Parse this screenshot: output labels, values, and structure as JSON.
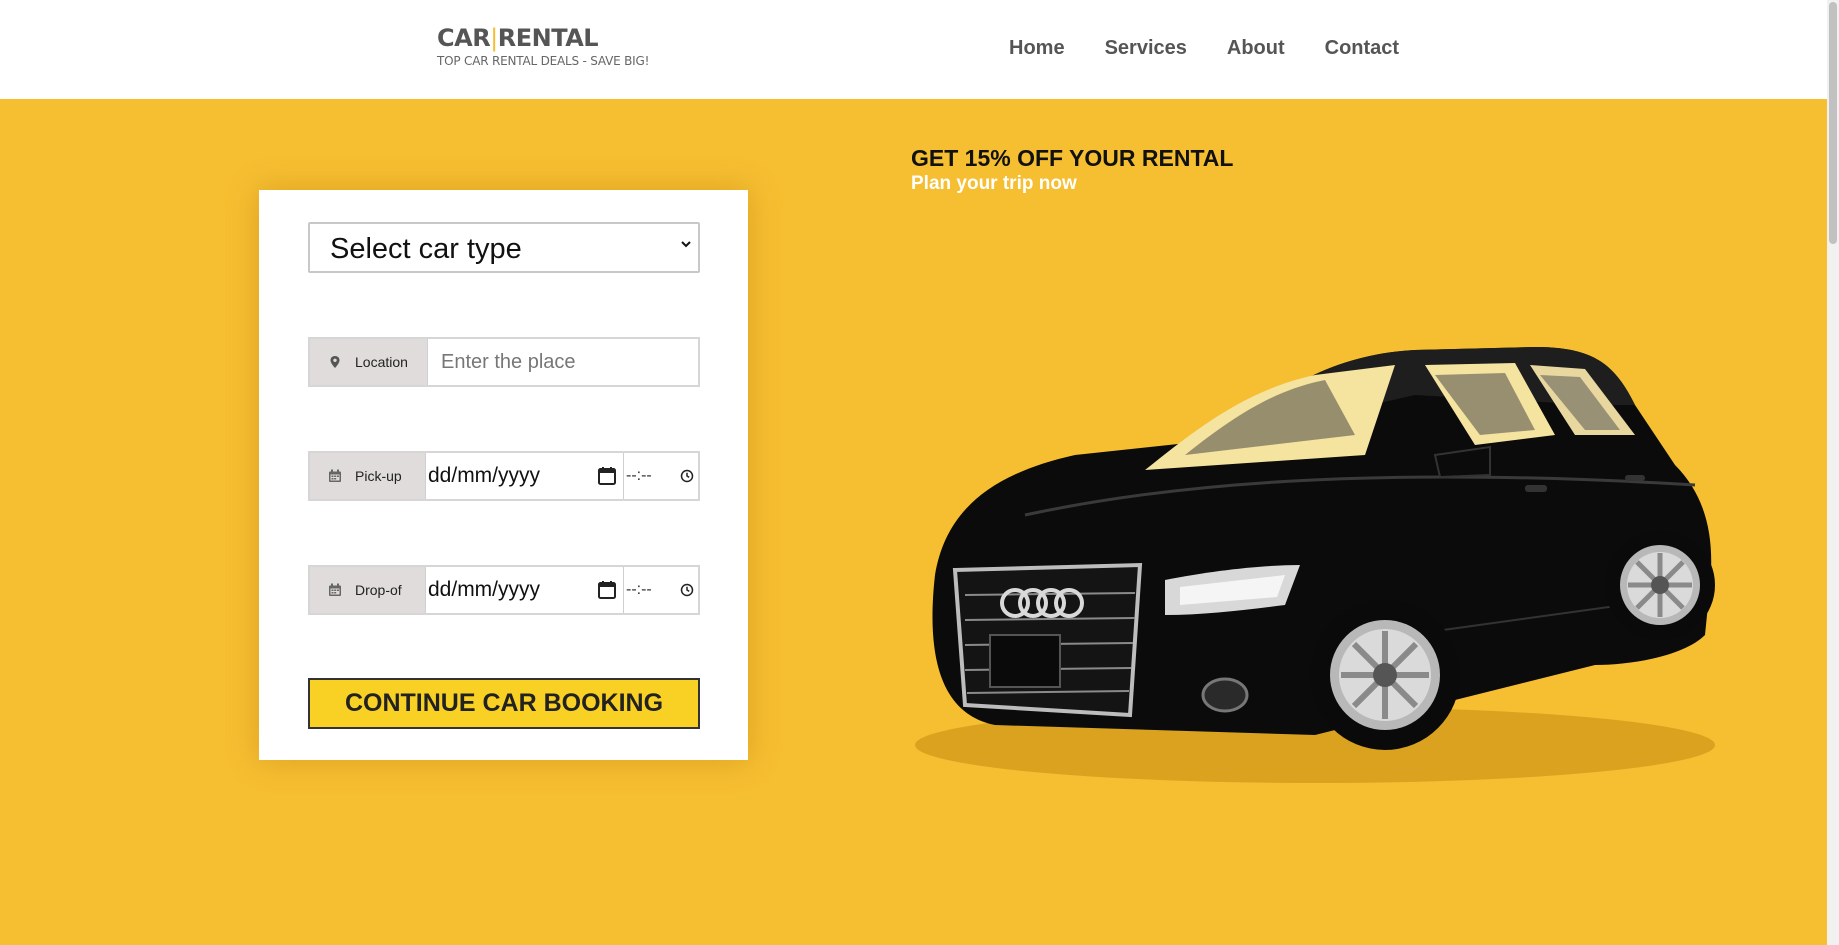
{
  "header": {
    "logo_left": "CAR",
    "logo_sep": "|",
    "logo_right": "RENTAL",
    "tagline": "TOP CAR RENTAL DEALS - SAVE BIG!",
    "nav": [
      {
        "label": "Home"
      },
      {
        "label": "Services"
      },
      {
        "label": "About"
      },
      {
        "label": "Contact"
      }
    ]
  },
  "booking": {
    "car_type_selected": "Select car type",
    "location_label": "Location",
    "location_placeholder": "Enter the place",
    "pickup_label": "Pick-up",
    "pickup_date": "dd/mm/yyyy",
    "pickup_time": "--:--",
    "dropoff_label": "Drop-of",
    "dropoff_date": "dd/mm/yyyy",
    "dropoff_time": "--:--",
    "continue_label": "CONTINUE CAR BOOKING"
  },
  "promo": {
    "title": "GET 15% OFF YOUR RENTAL",
    "subtitle": "Plan your trip now"
  },
  "icons": {
    "location": "map-marker-icon",
    "pickup": "calendar-icon",
    "dropoff": "calendar-icon",
    "select": "chevron-down-icon",
    "date": "calendar-icon",
    "time": "clock-icon"
  },
  "colors": {
    "accent": "#f6be31",
    "button": "#f9d125",
    "header_bg": "#ffffff",
    "text_dark": "#555555"
  }
}
